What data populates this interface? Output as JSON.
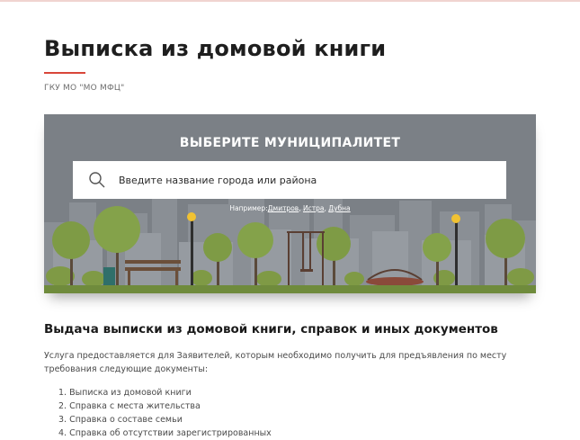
{
  "page": {
    "title": "Выписка из домовой книги",
    "organization": "ГКУ МО \"МО МФЦ\""
  },
  "hero": {
    "title": "ВЫБЕРИТЕ МУНИЦИПАЛИТЕТ",
    "search_placeholder": "Введите название города или района",
    "search_value": "",
    "search_icon": "search-icon",
    "examples_prefix": "Например:",
    "examples": [
      "Дмитров",
      "Истра",
      "Дубна"
    ]
  },
  "content": {
    "section_title": "Выдача выписки из домовой книги, справок и иных документов",
    "intro": "Услуга предоставляется для Заявителей, которым необходимо получить для предъявления по месту требования следующие документы:",
    "documents": [
      "1. Выписка из домовой книги",
      "2. Справка с места жительства",
      "3. Справка о составе семьи",
      "4. Справка об отсутствии зарегистрированных"
    ]
  },
  "colors": {
    "accent": "#d9463a",
    "hero_background": "#7a7f85",
    "grass": "#6f8b3c"
  }
}
